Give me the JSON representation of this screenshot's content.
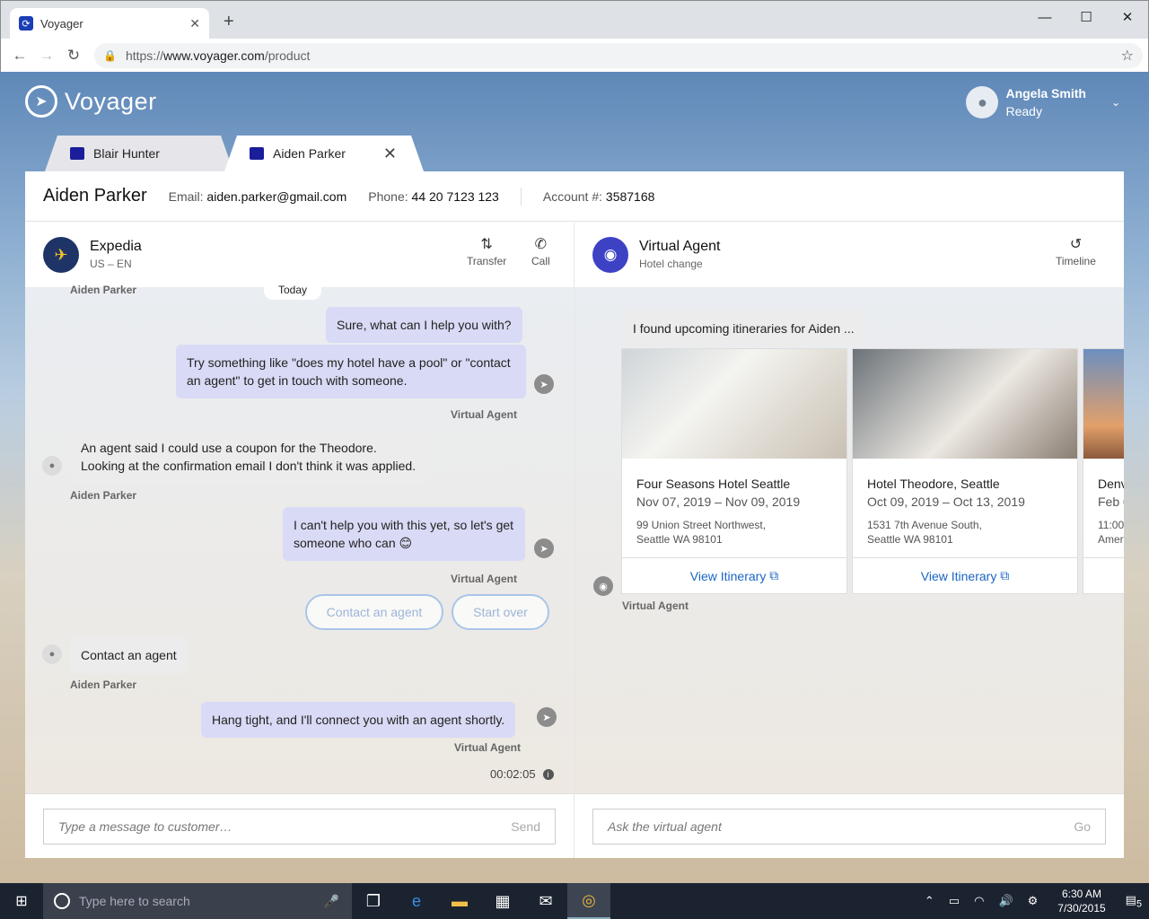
{
  "browser": {
    "tab_title": "Voyager",
    "url_scheme": "https://",
    "url_host": "www.voyager.com",
    "url_path": "/product"
  },
  "app": {
    "logo_text": "Voyager",
    "user_name": "Angela Smith",
    "user_status": "Ready"
  },
  "tabs": [
    {
      "label": "Blair Hunter"
    },
    {
      "label": "Aiden Parker"
    }
  ],
  "customer": {
    "name": "Aiden Parker",
    "email_label": "Email:",
    "email": "aiden.parker@gmail.com",
    "phone_label": "Phone:",
    "phone": "44 20 7123 123",
    "account_label": "Account #:",
    "account": "3587168"
  },
  "left_header": {
    "title": "Expedia",
    "subtitle": "US – EN",
    "transfer": "Transfer",
    "call": "Call"
  },
  "right_header": {
    "title": "Virtual Agent",
    "subtitle": "Hotel change",
    "timeline": "Timeline"
  },
  "chat": {
    "day_pill": "Today",
    "top_sender": "Aiden Parker",
    "messages": [
      {
        "text": "Sure, what can I help you with?"
      },
      {
        "text": "Try something like \"does my hotel have a pool\" or \"contact an agent\" to get in touch with someone.",
        "sender": "Virtual Agent"
      },
      {
        "text": "An agent said I could use a coupon for the Theodore. Looking at the confirmation email I don't think it was applied.",
        "sender": "Aiden Parker"
      },
      {
        "text": "I can't help you with this yet, so let's get someone who can 😊",
        "sender": "Virtual Agent"
      },
      {
        "text": "Contact an agent",
        "sender": "Aiden Parker"
      },
      {
        "text": "Hang tight, and I'll connect you with an agent shortly.",
        "sender": "Virtual Agent"
      }
    ],
    "quick_replies": [
      "Contact an agent",
      "Start over"
    ],
    "elapsed": "00:02:05"
  },
  "agent": {
    "intro": "I found upcoming itineraries for Aiden ...",
    "sender": "Virtual Agent",
    "cards": [
      {
        "name": "Four Seasons Hotel Seattle",
        "dates": "Nov 07,  2019 – Nov 09, 2019",
        "addr1": "99 Union Street Northwest,",
        "addr2": "Seattle WA 98101",
        "link": "View Itinerary"
      },
      {
        "name": "Hotel Theodore, Seattle",
        "dates": "Oct 09, 2019 – Oct 13, 2019",
        "addr1": "1531 7th Avenue South,",
        "addr2": "Seattle WA 98101",
        "link": "View Itinerary"
      },
      {
        "name": "Denv",
        "dates": "Feb 0",
        "addr1": "11:00",
        "addr2": "Ameri",
        "link": ""
      }
    ]
  },
  "composer": {
    "left_placeholder": "Type a message to customer…",
    "left_button": "Send",
    "right_placeholder": "Ask the virtual agent",
    "right_button": "Go"
  },
  "taskbar": {
    "search_placeholder": "Type here to search",
    "time": "6:30 AM",
    "date": "7/30/2015",
    "notif_count": "5"
  }
}
